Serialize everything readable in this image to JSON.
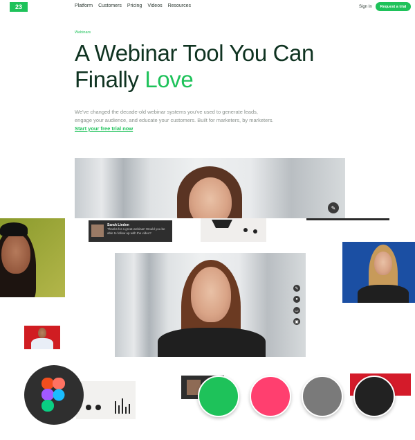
{
  "nav": {
    "logo": "23",
    "items": [
      "Platform",
      "Customers",
      "Pricing",
      "Videos",
      "Resources"
    ],
    "sign_in": "Sign In",
    "cta": "Request a trial"
  },
  "hero": {
    "eyebrow": "Webinars",
    "headline_part1": "A Webinar Tool You Can Finally",
    "headline_highlight": "Love",
    "subtext": "We've changed the decade-old webinar systems you've used to generate leads, engage your audience, and educate your customers. Built for marketers, by marketers.",
    "link": "Start your free trial now"
  },
  "chat": {
    "name": "Sarah Linden",
    "message": "Thanks for a great webinar! Would you be able to follow up with the video?"
  },
  "colors": {
    "brand_green": "#1ec25a",
    "pink": "#ff3f6f",
    "gray": "#7a7a7a",
    "black": "#222222"
  },
  "icons": [
    "pencil-icon",
    "mic-icon",
    "chat-icon",
    "screen-icon",
    "figma-icon"
  ]
}
